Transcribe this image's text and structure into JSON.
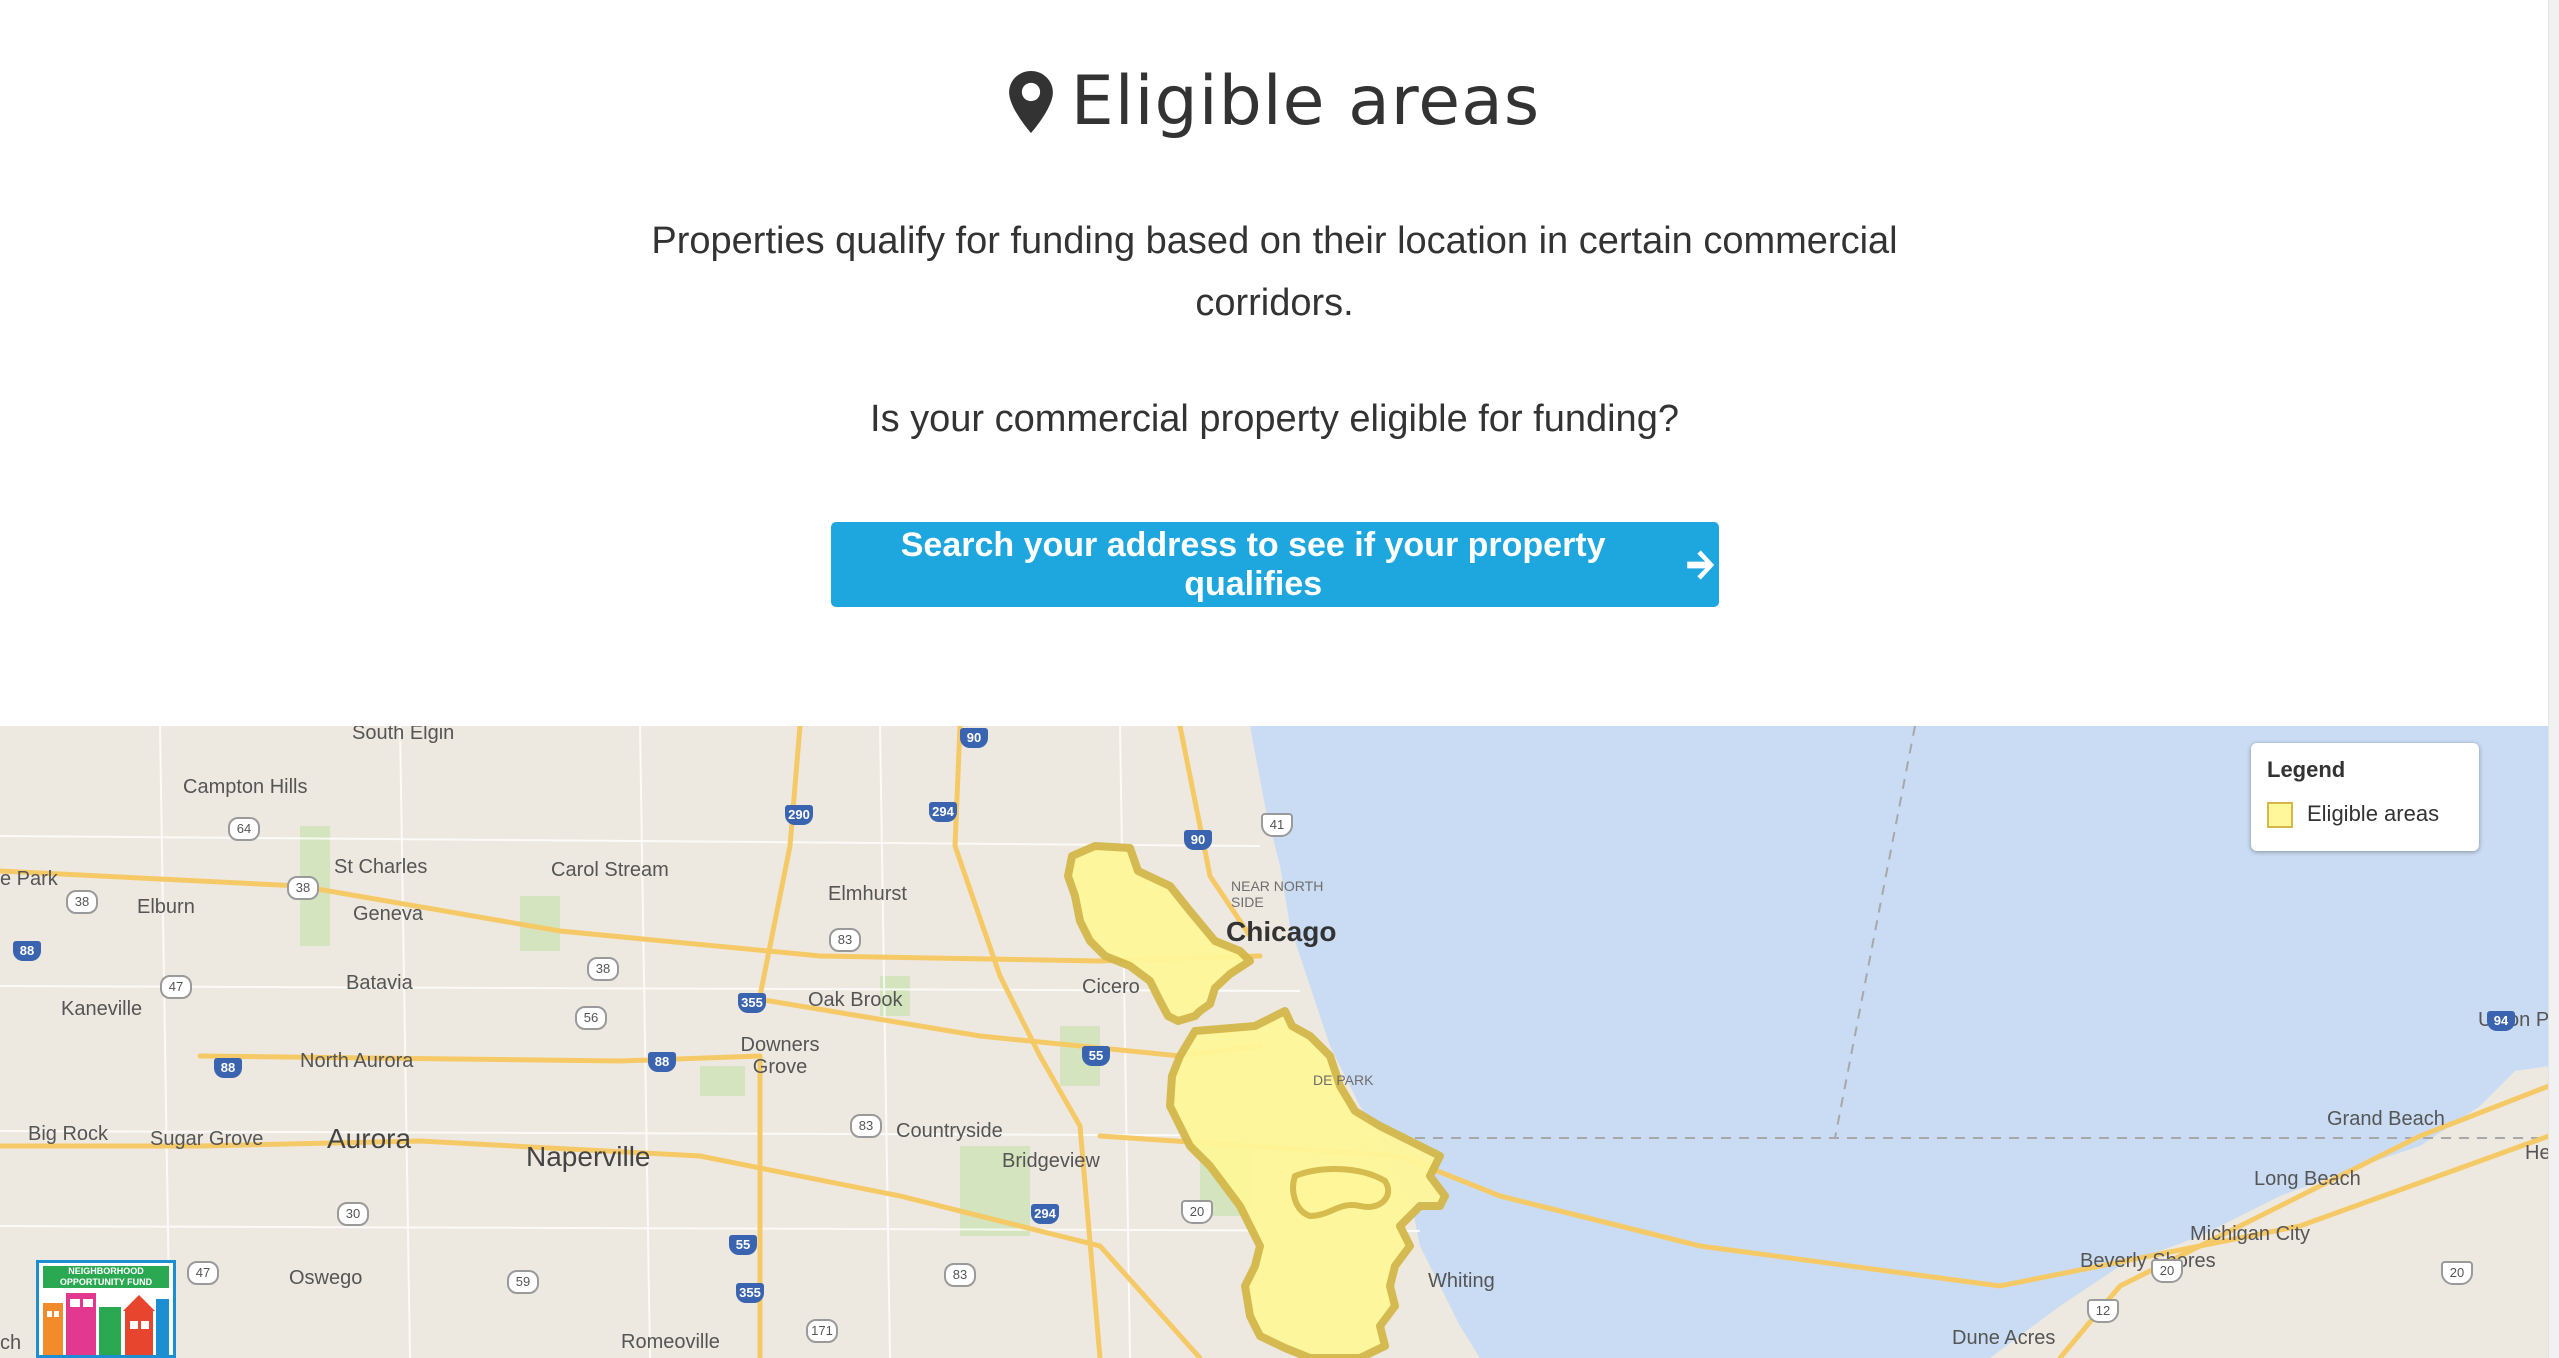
{
  "header": {
    "title": "Eligible areas",
    "description": "Properties qualify for funding based on their location in certain commercial corridors.",
    "question": "Is your commercial property eligible for funding?",
    "cta_label": "Search your address to see if your property qualifies",
    "cta_icon": "arrow-right-icon",
    "title_icon": "map-marker-icon"
  },
  "map": {
    "legend": {
      "title": "Legend",
      "items": [
        {
          "label": "Eligible areas",
          "color": "#fff799",
          "border": "#d4b84a"
        }
      ]
    },
    "colors": {
      "land": "#ede9e0",
      "water": "#c9dcf3",
      "highway": "#f6c967",
      "eligible_fill": "#fff799",
      "eligible_border": "#d4b84a"
    },
    "places": [
      {
        "name": "South Elgin"
      },
      {
        "name": "Campton Hills"
      },
      {
        "name": "St Charles"
      },
      {
        "name": "Carol Stream"
      },
      {
        "name": "Elmhurst"
      },
      {
        "name": "Geneva"
      },
      {
        "name": "Elburn"
      },
      {
        "name": "e Park"
      },
      {
        "name": "Batavia"
      },
      {
        "name": "Kaneville"
      },
      {
        "name": "Oak Brook"
      },
      {
        "name": "Downers Grove"
      },
      {
        "name": "North Aurora"
      },
      {
        "name": "Aurora"
      },
      {
        "name": "Naperville"
      },
      {
        "name": "Big Rock"
      },
      {
        "name": "Sugar Grove"
      },
      {
        "name": "Countryside"
      },
      {
        "name": "Bridgeview"
      },
      {
        "name": "Oswego"
      },
      {
        "name": "Romeoville"
      },
      {
        "name": "Whiting"
      },
      {
        "name": "Chicago"
      },
      {
        "name": "NEAR NORTH SIDE"
      },
      {
        "name": "Cicero"
      },
      {
        "name": "DE PARK"
      },
      {
        "name": "Union P"
      },
      {
        "name": "Grand Beach"
      },
      {
        "name": "Long Beach"
      },
      {
        "name": "Michigan City"
      },
      {
        "name": "Beverly Shores"
      },
      {
        "name": "Dune Acres"
      },
      {
        "name": "He"
      },
      {
        "name": "ch"
      }
    ],
    "shields": [
      "90",
      "290",
      "294",
      "64",
      "38",
      "38",
      "88",
      "41",
      "90",
      "83",
      "38",
      "47",
      "355",
      "56",
      "88",
      "88",
      "55",
      "83",
      "30",
      "294",
      "20",
      "55",
      "47",
      "59",
      "355",
      "83",
      "171",
      "94",
      "20",
      "12",
      "20"
    ],
    "logo_text": "NEIGHBORHOOD OPPORTUNITY FUND"
  }
}
